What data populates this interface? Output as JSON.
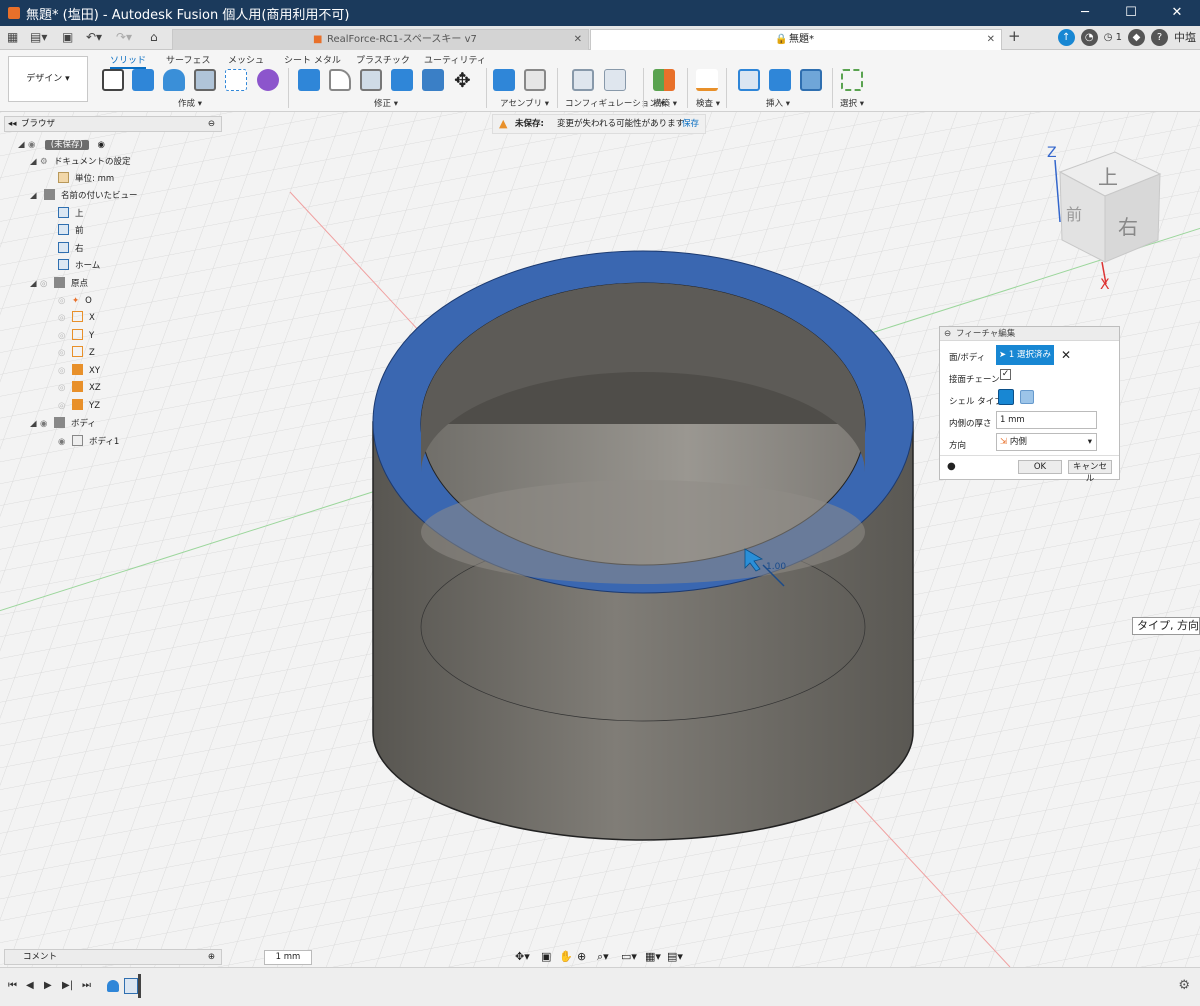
{
  "window": {
    "title": "無題* (塩田) - Autodesk Fusion 個人用(商用利用不可)",
    "minimize": "─",
    "maximize": "☐",
    "close": "✕"
  },
  "tabs": [
    {
      "label": "RealForce-RC1-スペースキー v7",
      "close": "✕"
    },
    {
      "label": "無題*",
      "close": "✕"
    }
  ],
  "tab_add": "+",
  "header_right": {
    "badge_count": "1",
    "user": "中塩"
  },
  "ribbon": {
    "workspace": "デザイン ▾",
    "tabs": [
      "ソリッド",
      "サーフェス",
      "メッシュ",
      "シート メタル",
      "プラスチック",
      "ユーティリティ"
    ],
    "groups": [
      "作成 ▾",
      "修正 ▾",
      "アセンブリ ▾",
      "コンフィギュレーション ▾",
      "構築 ▾",
      "検査 ▾",
      "挿入 ▾",
      "選択 ▾"
    ]
  },
  "warning": {
    "label": "未保存:",
    "message": "変更が失われる可能性があります",
    "save": "保存"
  },
  "browser": {
    "title": "ブラウザ",
    "items": [
      {
        "label": "(未保存)"
      },
      {
        "label": "ドキュメントの設定"
      },
      {
        "label": "単位: mm"
      },
      {
        "label": "名前の付いたビュー"
      },
      {
        "label": "上"
      },
      {
        "label": "前"
      },
      {
        "label": "右"
      },
      {
        "label": "ホーム"
      },
      {
        "label": "原点"
      },
      {
        "label": "O"
      },
      {
        "label": "X"
      },
      {
        "label": "Y"
      },
      {
        "label": "Z"
      },
      {
        "label": "XY"
      },
      {
        "label": "XZ"
      },
      {
        "label": "YZ"
      },
      {
        "label": "ボディ"
      },
      {
        "label": "ボディ1"
      }
    ]
  },
  "viewcube": {
    "top": "上",
    "front": "前",
    "right": "右",
    "axis_z": "Z",
    "axis_x": "X"
  },
  "dimension_label": "1.00",
  "feature_panel": {
    "title": "フィーチャ編集",
    "face_body_label": "面/ボディ",
    "selection": "1 選択済み",
    "tangent_chain_label": "接面チェーン",
    "tangent_chain_checked": true,
    "shell_type_label": "シェル タイプ",
    "inner_thickness_label": "内側の厚さ",
    "inner_thickness_value": "1 mm",
    "direction_label": "方向",
    "direction_value": "内側",
    "ok": "OK",
    "cancel": "キャンセル"
  },
  "tooltip": "タイプ, 方向",
  "bottom": {
    "comment": "コメント",
    "unit": "1 mm"
  },
  "colors": {
    "titlebar": "#1b3a5c",
    "accent": "#0a6fc2",
    "selected_face": "#3a67b1",
    "body": "#6b6964"
  }
}
